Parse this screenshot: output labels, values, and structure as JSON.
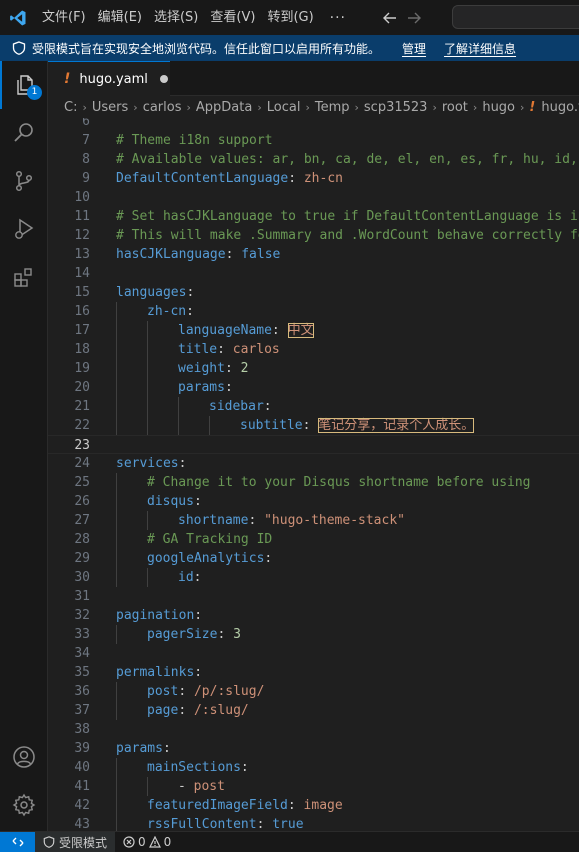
{
  "menu": [
    "文件(F)",
    "编辑(E)",
    "选择(S)",
    "查看(V)",
    "转到(G)"
  ],
  "menu_more": "···",
  "banner": {
    "text": "受限模式旨在实现安全地浏览代码。信任此窗口以启用所有功能。",
    "manage": "管理",
    "learn_more": "了解详细信息"
  },
  "activity": {
    "explorer_badge": "1"
  },
  "tab": {
    "label": "hugo.yaml",
    "icon": "!"
  },
  "breadcrumb": [
    "C:",
    "Users",
    "carlos",
    "AppData",
    "Local",
    "Temp",
    "scp31523",
    "root",
    "hugo",
    "hugo.yaml"
  ],
  "breadcrumb_icon": "!",
  "editor_lines": [
    {
      "n": "6",
      "tokens": []
    },
    {
      "n": "7",
      "tokens": [
        [
          "c-comment",
          "# Theme i18n support"
        ]
      ]
    },
    {
      "n": "8",
      "tokens": [
        [
          "c-comment",
          "# Available values: ar, bn, ca, de, el, en, es, fr, hu, id, it, ja, ko, nl, pt-br, th, uk, zh-cn, zh-hk, zh-tw"
        ]
      ]
    },
    {
      "n": "9",
      "tokens": [
        [
          "c-key",
          "DefaultContentLanguage"
        ],
        [
          "c-punct",
          ": "
        ],
        [
          "c-str",
          "zh-cn"
        ]
      ]
    },
    {
      "n": "10",
      "tokens": []
    },
    {
      "n": "11",
      "tokens": [
        [
          "c-comment",
          "# Set hasCJKLanguage to true if DefaultContentLanguage is in [zh-cn ja ko]"
        ]
      ]
    },
    {
      "n": "12",
      "tokens": [
        [
          "c-comment",
          "# This will make .Summary and .WordCount behave correctly for CJK languages."
        ]
      ]
    },
    {
      "n": "13",
      "tokens": [
        [
          "c-key",
          "hasCJKLanguage"
        ],
        [
          "c-punct",
          ": "
        ],
        [
          "c-bool",
          "false"
        ]
      ]
    },
    {
      "n": "14",
      "tokens": []
    },
    {
      "n": "15",
      "tokens": [
        [
          "c-key",
          "languages"
        ],
        [
          "c-punct",
          ":"
        ]
      ]
    },
    {
      "n": "16",
      "indent": 1,
      "tokens": [
        [
          "c-key",
          "zh-cn"
        ],
        [
          "c-punct",
          ":"
        ]
      ]
    },
    {
      "n": "17",
      "indent": 2,
      "tokens": [
        [
          "c-key",
          "languageName"
        ],
        [
          "c-punct",
          ": "
        ],
        [
          "c-highlight",
          "中文"
        ]
      ]
    },
    {
      "n": "18",
      "indent": 2,
      "tokens": [
        [
          "c-key",
          "title"
        ],
        [
          "c-punct",
          ": "
        ],
        [
          "c-str",
          "carlos"
        ]
      ]
    },
    {
      "n": "19",
      "indent": 2,
      "tokens": [
        [
          "c-key",
          "weight"
        ],
        [
          "c-punct",
          ": "
        ],
        [
          "c-num",
          "2"
        ]
      ]
    },
    {
      "n": "20",
      "indent": 2,
      "tokens": [
        [
          "c-key",
          "params"
        ],
        [
          "c-punct",
          ":"
        ]
      ]
    },
    {
      "n": "21",
      "indent": 3,
      "tokens": [
        [
          "c-key",
          "sidebar"
        ],
        [
          "c-punct",
          ":"
        ]
      ]
    },
    {
      "n": "22",
      "indent": 4,
      "tokens": [
        [
          "c-key",
          "subtitle"
        ],
        [
          "c-punct",
          ": "
        ],
        [
          "c-highlight",
          "笔记分享，记录个人成长。"
        ]
      ]
    },
    {
      "n": "23",
      "current": true,
      "tokens": []
    },
    {
      "n": "24",
      "tokens": [
        [
          "c-key",
          "services"
        ],
        [
          "c-punct",
          ":"
        ]
      ]
    },
    {
      "n": "25",
      "indent": 1,
      "tokens": [
        [
          "c-comment",
          "# Change it to your Disqus shortname before using"
        ]
      ]
    },
    {
      "n": "26",
      "indent": 1,
      "tokens": [
        [
          "c-key",
          "disqus"
        ],
        [
          "c-punct",
          ":"
        ]
      ]
    },
    {
      "n": "27",
      "indent": 2,
      "tokens": [
        [
          "c-key",
          "shortname"
        ],
        [
          "c-punct",
          ": "
        ],
        [
          "c-str",
          "\"hugo-theme-stack\""
        ]
      ]
    },
    {
      "n": "28",
      "indent": 1,
      "tokens": [
        [
          "c-comment",
          "# GA Tracking ID"
        ]
      ]
    },
    {
      "n": "29",
      "indent": 1,
      "tokens": [
        [
          "c-key",
          "googleAnalytics"
        ],
        [
          "c-punct",
          ":"
        ]
      ]
    },
    {
      "n": "30",
      "indent": 2,
      "tokens": [
        [
          "c-key",
          "id"
        ],
        [
          "c-punct",
          ":"
        ]
      ]
    },
    {
      "n": "31",
      "tokens": []
    },
    {
      "n": "32",
      "tokens": [
        [
          "c-key",
          "pagination"
        ],
        [
          "c-punct",
          ":"
        ]
      ]
    },
    {
      "n": "33",
      "indent": 1,
      "tokens": [
        [
          "c-key",
          "pagerSize"
        ],
        [
          "c-punct",
          ": "
        ],
        [
          "c-num",
          "3"
        ]
      ]
    },
    {
      "n": "34",
      "tokens": []
    },
    {
      "n": "35",
      "tokens": [
        [
          "c-key",
          "permalinks"
        ],
        [
          "c-punct",
          ":"
        ]
      ]
    },
    {
      "n": "36",
      "indent": 1,
      "tokens": [
        [
          "c-key",
          "post"
        ],
        [
          "c-punct",
          ": "
        ],
        [
          "c-str",
          "/p/:slug/"
        ]
      ]
    },
    {
      "n": "37",
      "indent": 1,
      "tokens": [
        [
          "c-key",
          "page"
        ],
        [
          "c-punct",
          ": "
        ],
        [
          "c-str",
          "/:slug/"
        ]
      ]
    },
    {
      "n": "38",
      "tokens": []
    },
    {
      "n": "39",
      "tokens": [
        [
          "c-key",
          "params"
        ],
        [
          "c-punct",
          ":"
        ]
      ]
    },
    {
      "n": "40",
      "indent": 1,
      "tokens": [
        [
          "c-key",
          "mainSections"
        ],
        [
          "c-punct",
          ":"
        ]
      ]
    },
    {
      "n": "41",
      "indent": 2,
      "tokens": [
        [
          "c-punct",
          "- "
        ],
        [
          "c-str",
          "post"
        ]
      ]
    },
    {
      "n": "42",
      "indent": 1,
      "tokens": [
        [
          "c-key",
          "featuredImageField"
        ],
        [
          "c-punct",
          ": "
        ],
        [
          "c-str",
          "image"
        ]
      ]
    },
    {
      "n": "43",
      "indent": 1,
      "tokens": [
        [
          "c-key",
          "rssFullContent"
        ],
        [
          "c-punct",
          ": "
        ],
        [
          "c-bool",
          "true"
        ]
      ]
    }
  ],
  "status": {
    "restricted_label": "受限模式",
    "errors": "0",
    "warnings": "0"
  },
  "colors": {
    "accent": "#0078d4",
    "banner_bg": "#0a3d6b",
    "comment": "#6a9955",
    "key": "#569cd6",
    "string": "#ce9178"
  }
}
